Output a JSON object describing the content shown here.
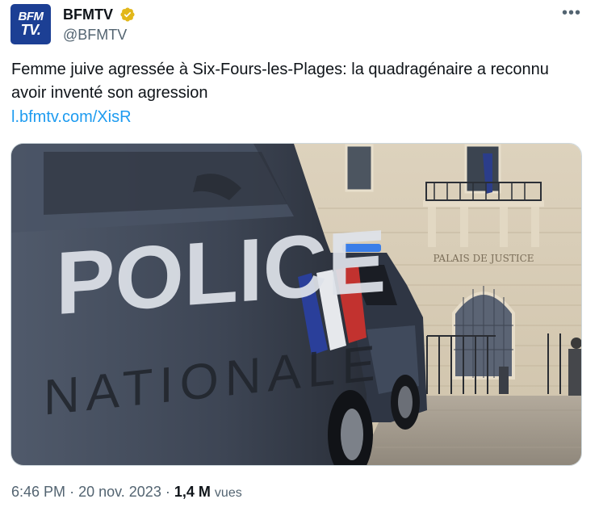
{
  "author": {
    "display_name": "BFMTV",
    "handle": "@BFMTV",
    "avatar_logo_line1": "BFM",
    "avatar_logo_line2": "TV.",
    "verified_icon": "verified-badge-icon",
    "verified_color": "#e2b719"
  },
  "tweet": {
    "text": "Femme juive agressée à Six-Fours-les-Plages: la quadragénaire a reconnu avoir inventé son agression",
    "link": "l.bfmtv.com/XisR",
    "more_icon": "more-icon"
  },
  "media": {
    "car_text": "POLICE",
    "car_text2": "NATIONALE",
    "building_sign": "PALAIS DE JUSTICE"
  },
  "meta": {
    "time": "6:46 PM",
    "separator": "·",
    "date": "20 nov. 2023",
    "views_count": "1,4 M",
    "views_label": "vues"
  },
  "colors": {
    "link": "#1d9bf0",
    "secondary_text": "#536471",
    "brand": "#1c3f94"
  }
}
